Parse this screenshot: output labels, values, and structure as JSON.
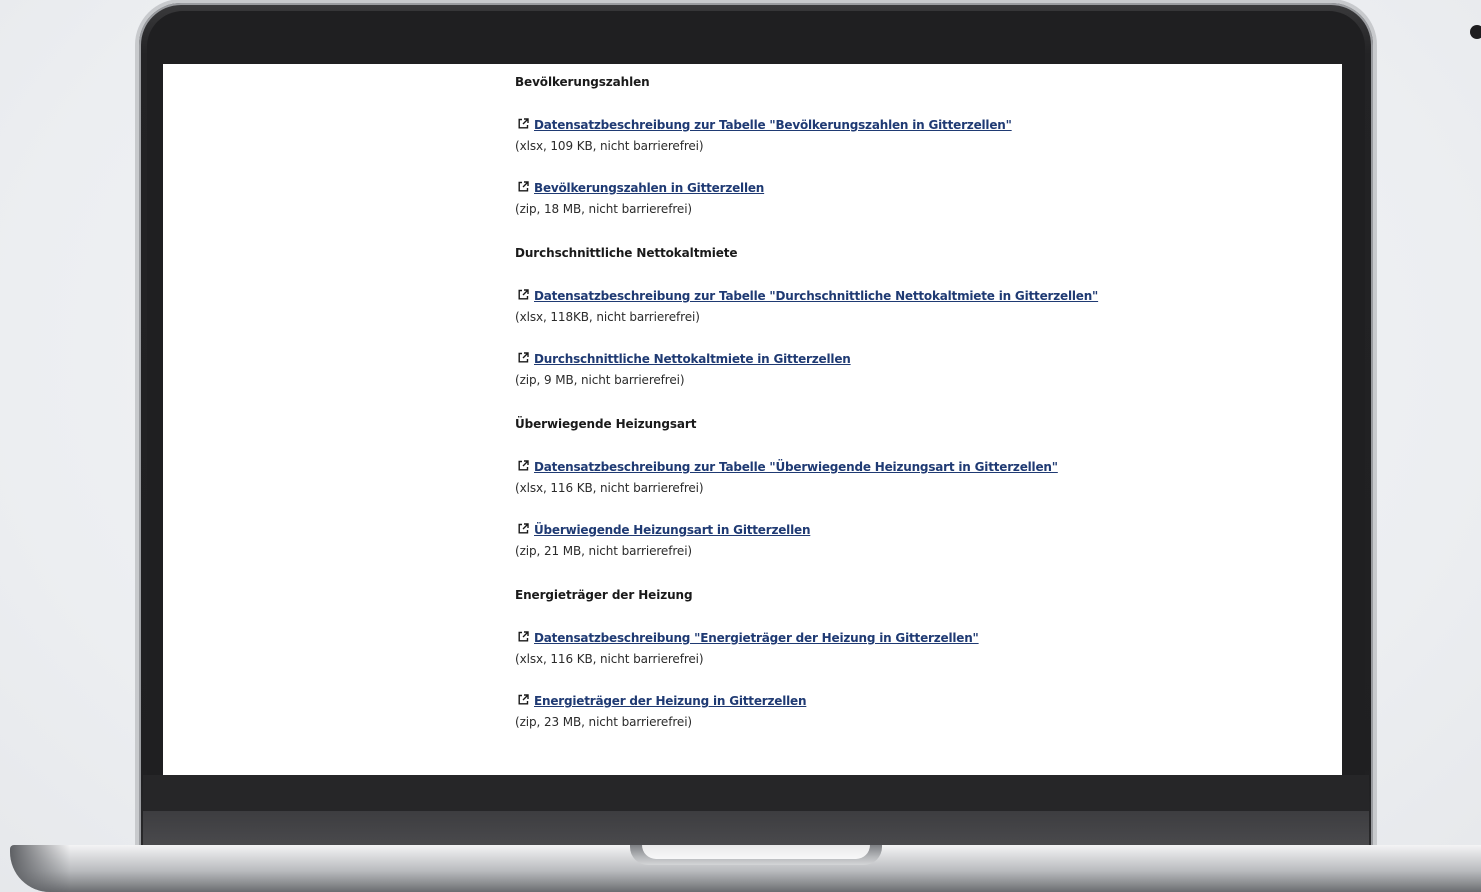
{
  "sections": [
    {
      "heading": "Bevölkerungszahlen",
      "downloads": [
        {
          "label": "Datensatzbeschreibung zur Tabelle \"Bevölkerungszahlen in Gitterzellen\"",
          "meta": "(xlsx, 109 KB, nicht barrierefrei)"
        },
        {
          "label": "Bevölkerungszahlen in Gitterzellen",
          "meta": "(zip, 18 MB, nicht barrierefrei)"
        }
      ]
    },
    {
      "heading": "Durchschnittliche Nettokaltmiete",
      "downloads": [
        {
          "label": "Datensatzbeschreibung zur Tabelle \"Durchschnittliche Nettokaltmiete in Gitterzellen\"",
          "meta": "(xlsx, 118KB, nicht barrierefrei)"
        },
        {
          "label": "Durchschnittliche Nettokaltmiete in Gitterzellen",
          "meta": "(zip, 9 MB, nicht barrierefrei)"
        }
      ]
    },
    {
      "heading": "Überwiegende Heizungsart",
      "downloads": [
        {
          "label": "Datensatzbeschreibung zur Tabelle \"Überwiegende Heizungsart in Gitterzellen\"",
          "meta": "(xlsx, 116 KB, nicht barrierefrei)"
        },
        {
          "label": "Überwiegende Heizungsart in Gitterzellen",
          "meta": "(zip, 21 MB, nicht barrierefrei)"
        }
      ]
    },
    {
      "heading": "Energieträger der Heizung",
      "downloads": [
        {
          "label": "Datensatzbeschreibung \"Energieträger der Heizung in Gitterzellen\"",
          "meta": "(xlsx, 116 KB, nicht barrierefrei)"
        },
        {
          "label": "Energieträger der Heizung in Gitterzellen",
          "meta": "(zip, 23 MB, nicht barrierefrei)"
        }
      ]
    }
  ],
  "icons": {
    "link": "external-link-icon"
  },
  "colors": {
    "link": "#1f3a73",
    "text": "#2b2b2b",
    "heading": "#1a1a1a"
  }
}
